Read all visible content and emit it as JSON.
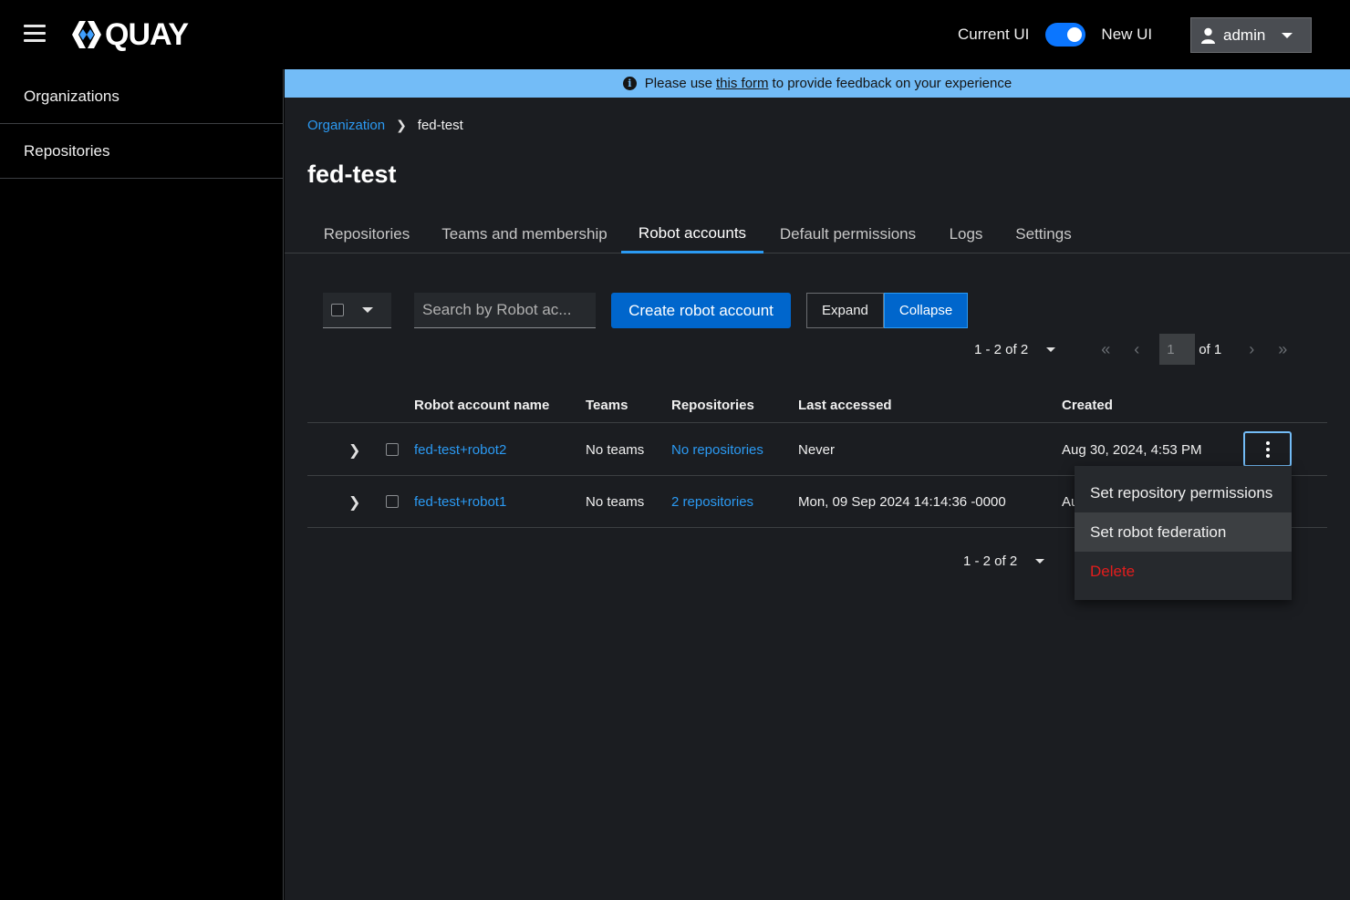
{
  "header": {
    "brand": "QUAY",
    "toggle_left_label": "Current UI",
    "toggle_right_label": "New UI",
    "user": "admin"
  },
  "sidebar": {
    "items": [
      {
        "label": "Organizations"
      },
      {
        "label": "Repositories"
      }
    ]
  },
  "banner": {
    "prefix": "Please use",
    "link": "this form",
    "suffix": "to provide feedback on your experience"
  },
  "breadcrumb": {
    "parent": "Organization",
    "current": "fed-test"
  },
  "page": {
    "title": "fed-test"
  },
  "tabs": [
    {
      "label": "Repositories"
    },
    {
      "label": "Teams and membership"
    },
    {
      "label": "Robot accounts",
      "active": true
    },
    {
      "label": "Default permissions"
    },
    {
      "label": "Logs"
    },
    {
      "label": "Settings"
    }
  ],
  "toolbar": {
    "search_placeholder": "Search by Robot ac...",
    "create_label": "Create robot account",
    "expand_label": "Expand",
    "collapse_label": "Collapse"
  },
  "pagination": {
    "range": "1 - 2 of 2",
    "page": "1",
    "of_label": "of 1"
  },
  "table": {
    "columns": [
      "Robot account name",
      "Teams",
      "Repositories",
      "Last accessed",
      "Created"
    ],
    "rows": [
      {
        "name": "fed-test+robot2",
        "teams": "No teams",
        "repos": "No repositories",
        "last_accessed": "Never",
        "created": "Aug 30, 2024, 4:53 PM"
      },
      {
        "name": "fed-test+robot1",
        "teams": "No teams",
        "repos": "2 repositories",
        "last_accessed": "Mon, 09 Sep 2024 14:14:36 -0000",
        "created": "Au"
      }
    ]
  },
  "row_menu": {
    "items": [
      {
        "label": "Set repository permissions"
      },
      {
        "label": "Set robot federation"
      },
      {
        "label": "Delete"
      }
    ]
  },
  "colors": {
    "accent": "#0066cc",
    "link": "#2b9af3",
    "banner": "#73bcf7",
    "danger": "#e21d1d"
  }
}
